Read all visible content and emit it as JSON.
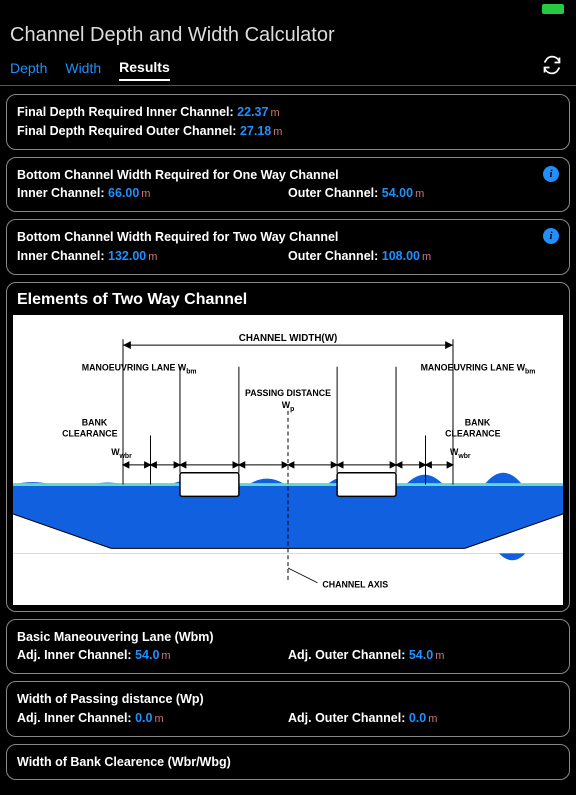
{
  "app": {
    "title": "Channel Depth and Width Calculator"
  },
  "tabs": {
    "depth": "Depth",
    "width": "Width",
    "results": "Results"
  },
  "final_depth": {
    "inner_label": "Final Depth Required Inner Channel:",
    "inner_value": "22.37",
    "outer_label": "Final Depth Required Outer Channel:",
    "outer_value": "27.18"
  },
  "one_way": {
    "title": "Bottom Channel Width Required for One Way Channel",
    "inner_label": "Inner Channel:",
    "inner_value": "66.00",
    "outer_label": "Outer Channel:",
    "outer_value": "54.00"
  },
  "two_way": {
    "title": "Bottom Channel Width Required for Two Way Channel",
    "inner_label": "Inner Channel:",
    "inner_value": "132.00",
    "outer_label": "Outer Channel:",
    "outer_value": "108.00"
  },
  "diagram": {
    "title": "Elements of Two Way Channel",
    "channel_width": "CHANNEL WIDTH(W)",
    "manoeuvring_left": "MANOEUVRING LANE W",
    "manoeuvring_right": "MANOEUVRING LANE W",
    "passing": "PASSING DISTANCE",
    "bank_left": "BANK CLEARANCE",
    "bank_right": "BANK CLEARANCE",
    "wbm": "bm",
    "wp": "W",
    "wp_sub": "p",
    "wwbr": "W",
    "wwbr_sub": "wbr",
    "channel_axis": "CHANNEL AXIS"
  },
  "wbm_panel": {
    "title": "Basic Maneouvering Lane (Wbm)",
    "inner_label": "Adj. Inner Channel:",
    "inner_value": "54.0",
    "outer_label": "Adj. Outer Channel:",
    "outer_value": "54.0"
  },
  "wp_panel": {
    "title": "Width of Passing distance (Wp)",
    "inner_label": "Adj. Inner Channel:",
    "inner_value": "0.0",
    "outer_label": "Adj. Outer Channel:",
    "outer_value": "0.0"
  },
  "wbr_panel": {
    "title": "Width of Bank Clearence (Wbr/Wbg)"
  },
  "unit": "m"
}
